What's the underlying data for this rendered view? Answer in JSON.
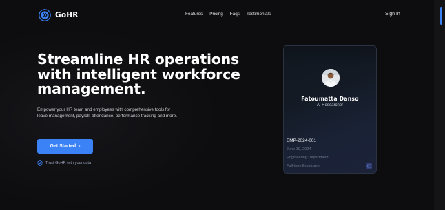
{
  "brand": {
    "name": "GoHR",
    "accent": "#3b82f6"
  },
  "nav": {
    "links": [
      "Features",
      "Pricing",
      "Faqs",
      "Testimonials"
    ],
    "sign_in": "Sign In"
  },
  "hero": {
    "headline": "Streamline HR operations with intelligent workforce management.",
    "subheadline": "Empower your HR team and employees with comprehensive tools for leave management, payroll, attendance, performance tracking and more.",
    "cta_label": "Get Started",
    "cta_icon": "chevron-right-icon",
    "trust_text": "Trust GoHR with your data",
    "trust_icon": "shield-check-icon"
  },
  "employee_card": {
    "name": "Fatoumatta Danso",
    "role": "AI Researcher",
    "employee_id": "EMP-2024-001",
    "join_date": "June 10, 2024",
    "department": "Engineering Department",
    "employment_type": "Full-time Employee",
    "avatar_icon": "user-photo",
    "badge_icon": "id-badge-icon"
  }
}
